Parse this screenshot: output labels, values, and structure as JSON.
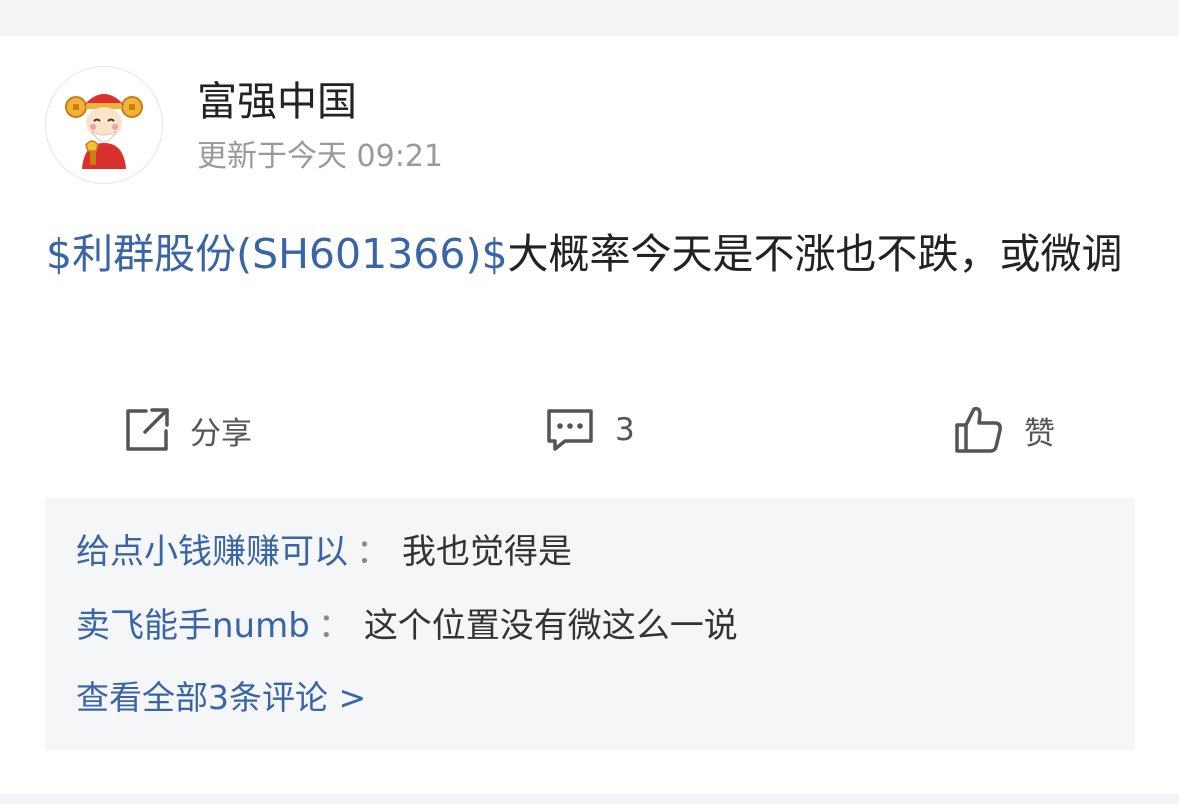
{
  "post": {
    "author": "富强中国",
    "time": "更新于今天 09:21",
    "stock_tag": "$利群股份(SH601366)$",
    "text": "大概率今天是不涨也不跌，或微调"
  },
  "actions": {
    "share_label": "分享",
    "comment_count": "3",
    "like_label": "赞"
  },
  "comments": [
    {
      "user": "给点小钱赚赚可以",
      "text": "我也觉得是"
    },
    {
      "user": "卖飞能手numb",
      "text": "这个位置没有微这么一说"
    }
  ],
  "comment_separator": "：",
  "view_all": "查看全部3条评论 >",
  "icons": {
    "share": "share-external-icon",
    "comment": "comment-bubble-icon",
    "like": "thumbs-up-icon",
    "avatar": "god-of-wealth-avatar"
  },
  "colors": {
    "link": "#3a64a8",
    "text": "#222222",
    "meta": "#9a9a9a",
    "comment_bg": "#f5f6f8"
  }
}
